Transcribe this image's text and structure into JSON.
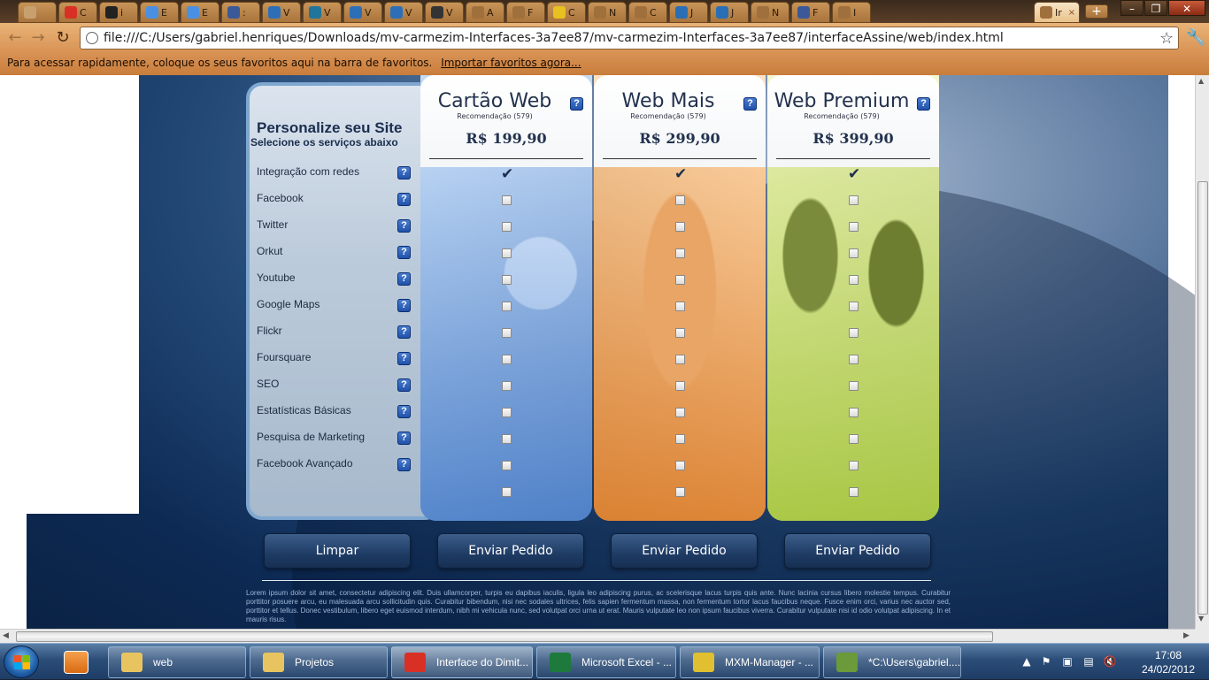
{
  "browser": {
    "tabs": [
      {
        "label": "",
        "icon": "app-icon",
        "color": "#c8a070"
      },
      {
        "label": "C",
        "icon": "gmail-icon",
        "color": "#d93025"
      },
      {
        "label": "i",
        "icon": "github-icon",
        "color": "#222222"
      },
      {
        "label": "E",
        "icon": "tab-icon",
        "color": "#4a90e2"
      },
      {
        "label": "E",
        "icon": "tab-icon",
        "color": "#4a90e2"
      },
      {
        "label": ":",
        "icon": "doc-icon",
        "color": "#3b5998"
      },
      {
        "label": "V",
        "icon": "drupal-icon",
        "color": "#2d6fb7"
      },
      {
        "label": "V",
        "icon": "wordpress-icon",
        "color": "#21759b"
      },
      {
        "label": "V",
        "icon": "drupal-icon",
        "color": "#2d6fb7"
      },
      {
        "label": "V",
        "icon": "drupal-icon",
        "color": "#2d6fb7"
      },
      {
        "label": "V",
        "icon": "image-icon",
        "color": "#333333"
      },
      {
        "label": "A",
        "icon": "globe-icon",
        "color": "#a0703c"
      },
      {
        "label": "F",
        "icon": "page-icon",
        "color": "#a0703c"
      },
      {
        "label": "C",
        "icon": "cn-icon",
        "color": "#e8c020"
      },
      {
        "label": "N",
        "icon": "globe-icon",
        "color": "#a0703c"
      },
      {
        "label": "C",
        "icon": "globe-icon",
        "color": "#a0703c"
      },
      {
        "label": "J",
        "icon": "aspnet-icon",
        "color": "#2a6fb5"
      },
      {
        "label": "J",
        "icon": "aspnet-icon",
        "color": "#2a6fb5"
      },
      {
        "label": "N",
        "icon": "globe-icon",
        "color": "#a0703c"
      },
      {
        "label": "F",
        "icon": "doc-icon",
        "color": "#3b5998"
      },
      {
        "label": "I",
        "icon": "globe-icon",
        "color": "#a0703c"
      }
    ],
    "active_tab": {
      "label": "Ir",
      "close": "×"
    },
    "new_tab": "+",
    "window_buttons": [
      "–",
      "❐",
      "✕"
    ],
    "url": "file:///C:/Users/gabriel.henriques/Downloads/mv-carmezim-Interfaces-3a7ee87/mv-carmezim-Interfaces-3a7ee87/interfaceAssine/web/index.html",
    "bookmarks_hint": "Para acessar rapidamente, coloque os seus favoritos aqui na barra de favoritos.",
    "bookmarks_import": "Importar favoritos agora..."
  },
  "panel": {
    "title": "Personalize seu Site",
    "subtitle": "Selecione os serviços abaixo"
  },
  "features": [
    "Integração com redes",
    "Facebook",
    "Twitter",
    "Orkut",
    "Youtube",
    "Google Maps",
    "Flickr",
    "Foursquare",
    "SEO",
    "Estatísticas Básicas",
    "Pesquisa de Marketing",
    "Facebook Avançado"
  ],
  "help_glyph": "?",
  "check_glyph": "✔",
  "plans": [
    {
      "name": "Cartão Web",
      "recommendation": "Recomendação (579)",
      "price": "R$ 199,90",
      "button": "Enviar Pedido",
      "accent": "#6f9bd8"
    },
    {
      "name": "Web Mais",
      "recommendation": "Recomendação (579)",
      "price": "R$ 299,90",
      "button": "Enviar Pedido",
      "accent": "#f3b070"
    },
    {
      "name": "Web Premium",
      "recommendation": "Recomendação (579)",
      "price": "R$ 399,90",
      "button": "Enviar Pedido",
      "accent": "#d6e68a"
    }
  ],
  "clear_button": "Limpar",
  "footer_text": "Lorem ipsum dolor sit amet, consectetur adipiscing elit. Duis ullamcorper, turpis eu dapibus iaculis, ligula leo adipiscing purus, ac scelerisque lacus turpis quis ante. Nunc lacinia cursus libero molestie tempus. Curabitur porttitor posuere arcu, eu malesuada arcu sollicitudin quis. Curabitur bibendum, nisi nec sodales ultrices, felis sapien fermentum massa, non fermentum tortor lacus faucibus neque. Fusce enim orci, varius nec auctor sed, porttitor et tellus. Donec vestibulum, libero eget euismod interdum, nibh mi vehicula nunc, sed volutpat orci urna ut erat. Mauris vulputate leo non ipsum faucibus viverra. Curabitur vulputate nisi id odio volutpat adipiscing. In et mauris risus.",
  "taskbar": {
    "items": [
      {
        "label": "web",
        "icon": "folder-icon",
        "color": "#e8c460"
      },
      {
        "label": "Projetos",
        "icon": "folder-icon",
        "color": "#e8c460"
      },
      {
        "label": "Interface do Dimit...",
        "icon": "chrome-icon",
        "color": "#d93025"
      },
      {
        "label": "Microsoft Excel - ...",
        "icon": "excel-icon",
        "color": "#1d7a3c"
      },
      {
        "label": "MXM-Manager - ...",
        "icon": "app-icon",
        "color": "#e0c030"
      },
      {
        "label": "*C:\\Users\\gabriel....",
        "icon": "notepad-icon",
        "color": "#6a9a3a"
      }
    ],
    "tray_icons": [
      "chevron-up-icon",
      "flag-icon",
      "network-icon",
      "display-icon",
      "volume-muted-icon"
    ],
    "time": "17:08",
    "date": "24/02/2012"
  }
}
